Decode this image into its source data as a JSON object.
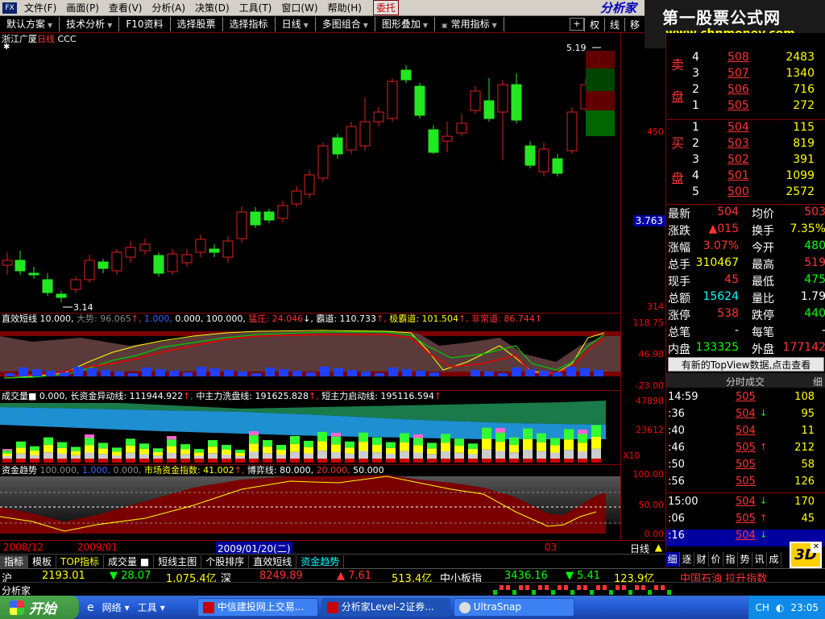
{
  "menu": {
    "items": [
      "文件(F)",
      "画面(P)",
      "查看(V)",
      "分析(A)",
      "决策(D)",
      "工具(T)",
      "窗口(W)",
      "帮助(H)"
    ],
    "weituo": "委托",
    "brand": "分析家"
  },
  "ad": {
    "line1": "第一股票公式网",
    "line2": "www.chnmoney.com"
  },
  "toolbar": {
    "items": [
      "默认方案",
      "技术分析",
      "F10资料",
      "选择股票",
      "选择指标",
      "日线",
      "多图组合",
      "图形叠加",
      "常用指标"
    ],
    "right": [
      "权",
      "线",
      "移"
    ]
  },
  "chart": {
    "title_name": "浙江广厦",
    "title_period": "日线",
    "title_formula": "CCC",
    "high_label": "5.19",
    "low_label": "3.14"
  },
  "axis": {
    "labels": [
      "450",
      "3.763",
      "314"
    ],
    "s1": [
      "118.75",
      "46.98",
      "-23.00"
    ],
    "s2": [
      "47898",
      "23612",
      "X10"
    ],
    "s3": [
      "100.00",
      "50.00",
      "0.00"
    ]
  },
  "sub1": {
    "name": "直效短线",
    "v1": "10.000,",
    "v2": "大势: 96.065",
    "v3": "1.000,",
    "v4": "0.000,",
    "v5": "100.000,",
    "l1": "猛庄: 24.046",
    "l2": "霸道: 110.733",
    "l3": "极霸道: 101.504",
    "l4": "非常道: 86.744"
  },
  "sub2": {
    "name": "成交量",
    "v0": "0.000,",
    "l1": "长资金异动线: 111944.922",
    "l2": "中主力洗盘线: 191625.828",
    "l3": "短主力启动线: 195116.594"
  },
  "sub3": {
    "name": "资金趋势",
    "v1": "100.000,",
    "v2": "1.000,",
    "v3": "0.000,",
    "l1": "市场资金指数: 41.002",
    "l2": "博弈线: 80.000,",
    "l3": "20.000,",
    "l4": "50.000"
  },
  "datebar": {
    "d1": "2008/12",
    "d2": "2009/01",
    "sel": "2009/01/20(二)",
    "d3": "03",
    "kind": "日线"
  },
  "tabs": [
    "指标",
    "模板",
    "TOP指标",
    "成交量",
    "短线主图",
    "个股排序",
    "直效短线",
    "资金趋势"
  ],
  "orderbook": {
    "sell_label": [
      "卖",
      "盘"
    ],
    "buy_label": [
      "买",
      "盘"
    ],
    "sell": [
      {
        "n": "4",
        "p": "508",
        "v": "2483"
      },
      {
        "n": "3",
        "p": "507",
        "v": "1340"
      },
      {
        "n": "2",
        "p": "506",
        "v": "716"
      },
      {
        "n": "1",
        "p": "505",
        "v": "272"
      }
    ],
    "buy": [
      {
        "n": "1",
        "p": "504",
        "v": "115"
      },
      {
        "n": "2",
        "p": "503",
        "v": "819"
      },
      {
        "n": "3",
        "p": "502",
        "v": "391"
      },
      {
        "n": "4",
        "p": "501",
        "v": "1099"
      },
      {
        "n": "5",
        "p": "500",
        "v": "2572"
      }
    ]
  },
  "quote": [
    {
      "l": "最新",
      "lv": "504",
      "r": "均价",
      "rv": "503"
    },
    {
      "l": "涨跌",
      "lv": "▲015",
      "r": "换手",
      "rv": "7.35%"
    },
    {
      "l": "涨幅",
      "lv": "3.07%",
      "r": "今开",
      "rv": "480"
    },
    {
      "l": "总手",
      "lv": "310467",
      "r": "最高",
      "rv": "519"
    },
    {
      "l": "现手",
      "lv": "45",
      "r": "最低",
      "rv": "475"
    },
    {
      "l": "总额",
      "lv": "15624",
      "r": "量比",
      "rv": "1.79"
    },
    {
      "l": "涨停",
      "lv": "538",
      "r": "跌停",
      "rv": "440"
    },
    {
      "l": "总笔",
      "lv": "-",
      "r": "每笔",
      "rv": "-"
    },
    {
      "l": "内盘",
      "lv": "133325",
      "r": "外盘",
      "rv": "177142"
    }
  ],
  "topview": "有新的TopView数据,点击查看",
  "tick_header": {
    "title": "分时成交",
    "detail": "细"
  },
  "ticks": [
    {
      "t": "14:59",
      "p": "505",
      "a": "",
      "v": "108"
    },
    {
      "t": ":36",
      "p": "504",
      "a": "↓",
      "v": "95"
    },
    {
      "t": ":40",
      "p": "504",
      "a": "",
      "v": "11"
    },
    {
      "t": ":46",
      "p": "505",
      "a": "↑",
      "v": "212"
    },
    {
      "t": ":50",
      "p": "505",
      "a": "",
      "v": "58"
    },
    {
      "t": ":56",
      "p": "505",
      "a": "",
      "v": "126"
    },
    {
      "t": "15:00",
      "p": "504",
      "a": "↓",
      "v": "170"
    },
    {
      "t": ":06",
      "p": "505",
      "a": "↑",
      "v": "45"
    },
    {
      "t": ":16",
      "p": "504",
      "a": "↓",
      "v": ""
    }
  ],
  "rtabs": [
    "细",
    "逐",
    "财",
    "价",
    "指",
    "势",
    "讯",
    "成"
  ],
  "logo3d": "3D",
  "ticker": {
    "sh": "沪",
    "sh_idx": "2193.01",
    "sh_chg": "▼ 28.07",
    "sh_amt": "1,075.4亿",
    "sz": "深",
    "sz_idx": "8249.89",
    "sz_chg": "▲ 7.61",
    "sz_amt": "513.4亿",
    "zx": "中小板指",
    "zx_idx": "3436.16",
    "zx_chg": "▼ 5.41",
    "zx_amt": "123.9亿",
    "news": "中国石油 拉升指数"
  },
  "status": {
    "name": "分析家"
  },
  "taskbar": {
    "start": "开始",
    "net": "网络",
    "tools": "工具",
    "tasks": [
      "中信建投网上交易...",
      "分析家Level-2证券...",
      "UltraSnap"
    ],
    "lang": "CH",
    "time": "23:05"
  }
}
